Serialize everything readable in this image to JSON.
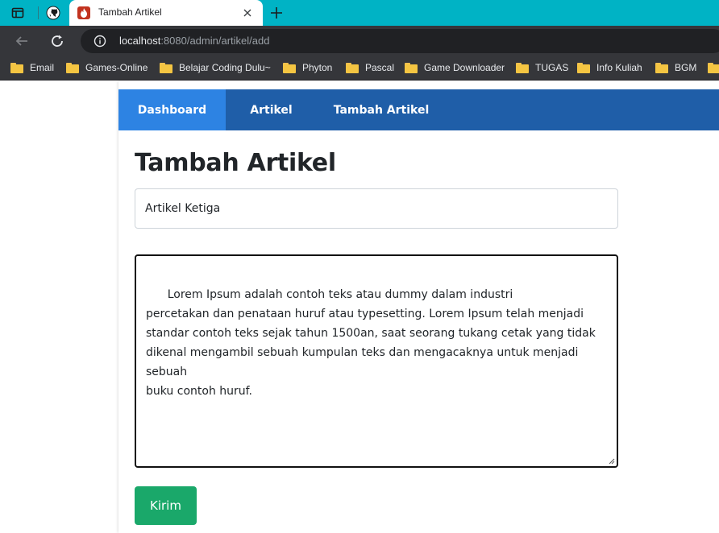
{
  "browser": {
    "tab": {
      "title": "Tambah Artikel"
    },
    "address": {
      "host": "localhost",
      "rest": ":8080/admin/artikel/add"
    },
    "bookmarks": [
      {
        "label": "Email",
        "icon": "folder-icon"
      },
      {
        "label": "Games-Online",
        "icon": "folder-icon"
      },
      {
        "label": "Belajar Coding Dulu~",
        "icon": "folder-icon"
      },
      {
        "label": "Phyton",
        "icon": "folder-icon"
      },
      {
        "label": "Pascal",
        "icon": "folder-icon"
      },
      {
        "label": "Game Downloader",
        "icon": "folder-icon"
      },
      {
        "label": "TUGAS",
        "icon": "folder-icon"
      },
      {
        "label": "Info Kuliah",
        "icon": "folder-icon"
      },
      {
        "label": "BGM",
        "icon": "folder-icon"
      }
    ]
  },
  "nav": {
    "items": [
      {
        "label": "Dashboard",
        "active": true
      },
      {
        "label": "Artikel",
        "active": false
      },
      {
        "label": "Tambah Artikel",
        "active": false
      }
    ]
  },
  "form": {
    "heading": "Tambah Artikel",
    "title_value": "Artikel Ketiga",
    "content_value": "Lorem Ipsum adalah contoh teks atau dummy dalam industri\npercetakan dan penataan huruf atau typesetting. Lorem Ipsum telah menjadi\nstandar contoh teks sejak tahun 1500an, saat seorang tukang cetak yang tidak\ndikenal mengambil sebuah kumpulan teks dan mengacaknya untuk menjadi\nsebuah\nbuku contoh huruf.",
    "submit_label": "Kirim"
  },
  "colors": {
    "tabstrip": "#00b3c5",
    "navbar": "#1f5ea8",
    "nav_active": "#2d83e3",
    "submit": "#1aa86a"
  }
}
